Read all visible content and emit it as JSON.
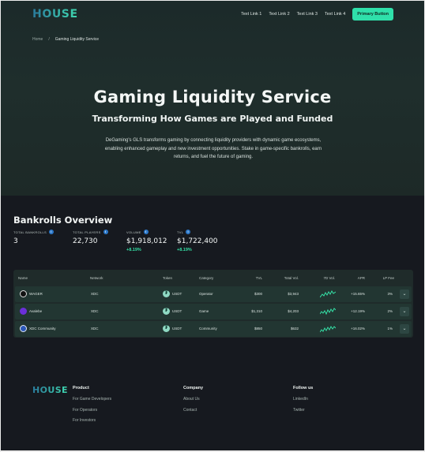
{
  "header": {
    "logo": "HOUSE",
    "nav_links": [
      "Text Link 1",
      "Text Link 2",
      "Text Link 3",
      "Text Link 4"
    ],
    "primary_button": "Primary Button"
  },
  "breadcrumb": {
    "home": "Home",
    "separator": "/",
    "current": "Gaming Liquidity Service"
  },
  "hero": {
    "title": "Gaming Liquidity Service",
    "subtitle": "Transforming How Games are Played and Funded",
    "description": "DeGaming's GLS transforms gaming by connecting liquidity providers with dynamic game ecosystems, enabling enhanced gameplay and new investment opportunities. Stake in game-specific bankrolls, earn returns, and fuel the future of gaming."
  },
  "bankrolls": {
    "title": "Bankrolls Overview",
    "stats": [
      {
        "label": "TOTAL BANKROLLS",
        "value": "3",
        "change": ""
      },
      {
        "label": "TOTAL PLAYERS",
        "value": "22,730",
        "change": ""
      },
      {
        "label": "VOLUME",
        "value": "$1,918,012",
        "change": "+8.19%"
      },
      {
        "label": "TVL",
        "value": "$1,722,400",
        "change": "+8.19%"
      }
    ],
    "columns": [
      "Name",
      "Network",
      "Token",
      "Category",
      "TVL",
      "Total Vol.",
      "7D Vol.",
      "APR",
      "LP Fee"
    ],
    "rows": [
      {
        "name": "WAGER",
        "network": "XDC",
        "token": "USDT",
        "category": "Operator",
        "tvl": "$300",
        "total_vol": "$3,943",
        "apr": "+15.65%",
        "lp_fee": "3%",
        "avatar_color": "#1a1a1a"
      },
      {
        "name": "Avalebe",
        "network": "XDC",
        "token": "USDT",
        "category": "Game",
        "tvl": "$1,310",
        "total_vol": "$4,203",
        "apr": "+12.19%",
        "lp_fee": "2%",
        "avatar_color": "#6b2fd9"
      },
      {
        "name": "XDC Community",
        "network": "XDC",
        "token": "USDT",
        "category": "Community",
        "tvl": "$850",
        "total_vol": "$632",
        "apr": "+16.02%",
        "lp_fee": "1%",
        "avatar_color": "#2b58b8"
      }
    ]
  },
  "footer": {
    "logo": "HOUSE",
    "columns": [
      {
        "title": "Product",
        "links": [
          "For Game Developers",
          "For Operators",
          "For Investors"
        ]
      },
      {
        "title": "Company",
        "links": [
          "About Us",
          "Contact"
        ]
      },
      {
        "title": "Follow us",
        "links": [
          "LinkedIn",
          "Twitter"
        ]
      }
    ]
  },
  "colors": {
    "accent": "#2fe0aa",
    "positive": "#35e0a6",
    "info": "#2c78c9"
  },
  "icons": {
    "info": "info-icon",
    "chevron": "chevron-down-icon",
    "token": "tether-icon"
  }
}
